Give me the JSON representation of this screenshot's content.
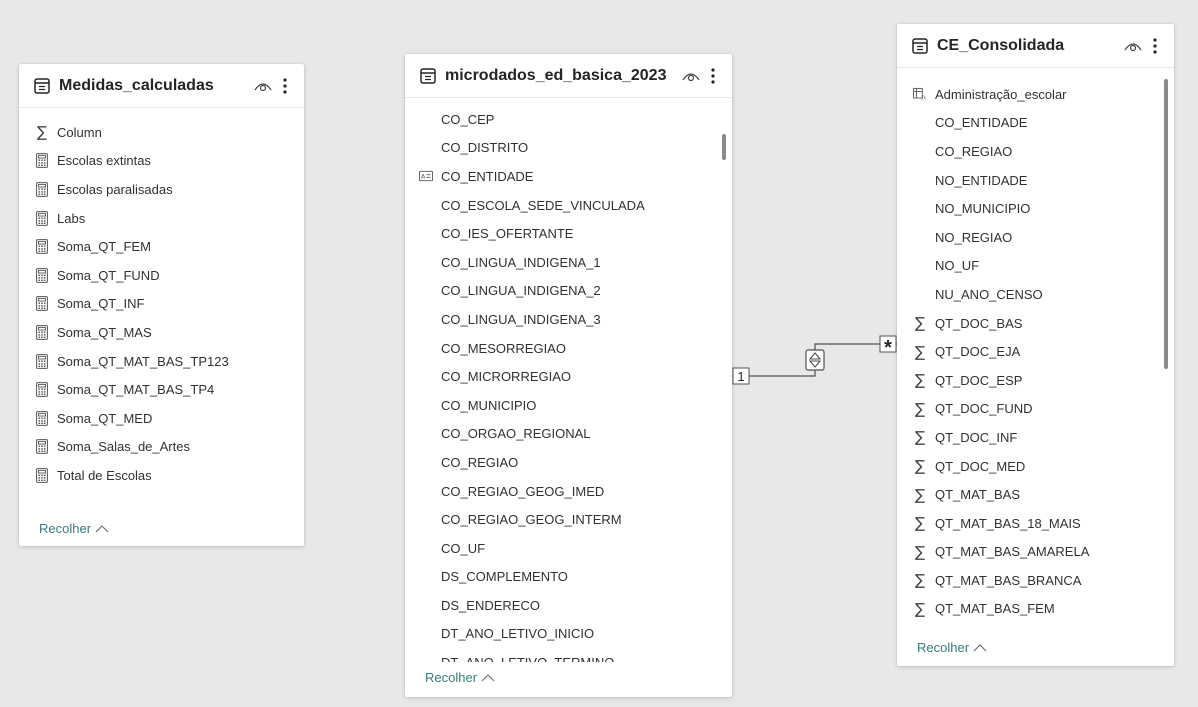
{
  "tables": {
    "measures": {
      "title": "Medidas_calculadas",
      "fields": [
        {
          "label": "Column",
          "icon": "sigma-icon"
        },
        {
          "label": "Escolas extintas",
          "icon": "calculator-icon"
        },
        {
          "label": "Escolas paralisadas",
          "icon": "calculator-icon"
        },
        {
          "label": "Labs",
          "icon": "calculator-icon"
        },
        {
          "label": "Soma_QT_FEM",
          "icon": "calculator-icon"
        },
        {
          "label": "Soma_QT_FUND",
          "icon": "calculator-icon"
        },
        {
          "label": "Soma_QT_INF",
          "icon": "calculator-icon"
        },
        {
          "label": "Soma_QT_MAS",
          "icon": "calculator-icon"
        },
        {
          "label": "Soma_QT_MAT_BAS_TP123",
          "icon": "calculator-icon"
        },
        {
          "label": "Soma_QT_MAT_BAS_TP4",
          "icon": "calculator-icon"
        },
        {
          "label": "Soma_QT_MED",
          "icon": "calculator-icon"
        },
        {
          "label": "Soma_Salas_de_Artes",
          "icon": "calculator-icon"
        },
        {
          "label": "Total de Escolas",
          "icon": "calculator-icon"
        }
      ],
      "collapse_label": "Recolher"
    },
    "microdados": {
      "title": "microdados_ed_basica_2023",
      "fields": [
        {
          "label": "CO_CEP",
          "icon": ""
        },
        {
          "label": "CO_DISTRITO",
          "icon": ""
        },
        {
          "label": "CO_ENTIDADE",
          "icon": "key-field-icon"
        },
        {
          "label": "CO_ESCOLA_SEDE_VINCULADA",
          "icon": ""
        },
        {
          "label": "CO_IES_OFERTANTE",
          "icon": ""
        },
        {
          "label": "CO_LINGUA_INDIGENA_1",
          "icon": ""
        },
        {
          "label": "CO_LINGUA_INDIGENA_2",
          "icon": ""
        },
        {
          "label": "CO_LINGUA_INDIGENA_3",
          "icon": ""
        },
        {
          "label": "CO_MESORREGIAO",
          "icon": ""
        },
        {
          "label": "CO_MICRORREGIAO",
          "icon": ""
        },
        {
          "label": "CO_MUNICIPIO",
          "icon": ""
        },
        {
          "label": "CO_ORGAO_REGIONAL",
          "icon": ""
        },
        {
          "label": "CO_REGIAO",
          "icon": ""
        },
        {
          "label": "CO_REGIAO_GEOG_IMED",
          "icon": ""
        },
        {
          "label": "CO_REGIAO_GEOG_INTERM",
          "icon": ""
        },
        {
          "label": "CO_UF",
          "icon": ""
        },
        {
          "label": "DS_COMPLEMENTO",
          "icon": ""
        },
        {
          "label": "DS_ENDERECO",
          "icon": ""
        },
        {
          "label": "DT_ANO_LETIVO_INICIO",
          "icon": ""
        },
        {
          "label": "DT_ANO_LETIVO_TERMINO",
          "icon": ""
        }
      ],
      "collapse_label": "Recolher"
    },
    "consolidada": {
      "title": "CE_Consolidada",
      "fields": [
        {
          "label": "Administração_escolar",
          "icon": "hierarchy-icon"
        },
        {
          "label": "CO_ENTIDADE",
          "icon": ""
        },
        {
          "label": "CO_REGIAO",
          "icon": ""
        },
        {
          "label": "NO_ENTIDADE",
          "icon": ""
        },
        {
          "label": "NO_MUNICIPIO",
          "icon": ""
        },
        {
          "label": "NO_REGIAO",
          "icon": ""
        },
        {
          "label": "NO_UF",
          "icon": ""
        },
        {
          "label": "NU_ANO_CENSO",
          "icon": ""
        },
        {
          "label": "QT_DOC_BAS",
          "icon": "sigma-icon"
        },
        {
          "label": "QT_DOC_EJA",
          "icon": "sigma-icon"
        },
        {
          "label": "QT_DOC_ESP",
          "icon": "sigma-icon"
        },
        {
          "label": "QT_DOC_FUND",
          "icon": "sigma-icon"
        },
        {
          "label": "QT_DOC_INF",
          "icon": "sigma-icon"
        },
        {
          "label": "QT_DOC_MED",
          "icon": "sigma-icon"
        },
        {
          "label": "QT_MAT_BAS",
          "icon": "sigma-icon"
        },
        {
          "label": "QT_MAT_BAS_18_MAIS",
          "icon": "sigma-icon"
        },
        {
          "label": "QT_MAT_BAS_AMARELA",
          "icon": "sigma-icon"
        },
        {
          "label": "QT_MAT_BAS_BRANCA",
          "icon": "sigma-icon"
        },
        {
          "label": "QT_MAT_BAS_FEM",
          "icon": "sigma-icon"
        }
      ],
      "collapse_label": "Recolher"
    }
  },
  "relationship": {
    "from_cardinality": "1",
    "to_cardinality": "*"
  }
}
